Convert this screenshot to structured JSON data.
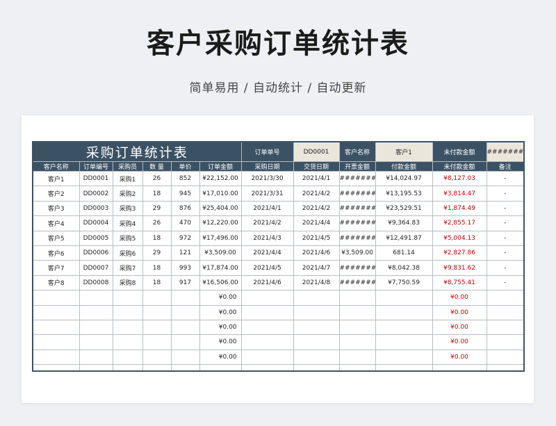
{
  "page": {
    "title": "客户采购订单统计表",
    "subtitle": "简单易用  /  自动统计  /  自动更新"
  },
  "summary": {
    "sheet_title": "采购订单统计表",
    "order_no_label": "订单单号",
    "order_no_value": "DD0001",
    "customer_label": "客户名称",
    "customer_value": "客户1",
    "unpaid_label": "未付款金额",
    "unpaid_value": "#########"
  },
  "columns": [
    "客户名称",
    "订单编号",
    "采购员",
    "数 量",
    "单价",
    "订单金额",
    "采购日期",
    "交货日期",
    "开票金额",
    "付款金额",
    "未付款金额",
    "备注"
  ],
  "rows": [
    [
      "客户1",
      "DD0001",
      "采购1",
      "26",
      "852",
      "¥22,152.00",
      "2021/3/30",
      "2021/4/1",
      "#########",
      "¥14,024.97",
      "¥8,127.03",
      "-"
    ],
    [
      "客户2",
      "DD0002",
      "采购2",
      "18",
      "945",
      "¥17,010.00",
      "2021/3/31",
      "2021/4/2",
      "#########",
      "¥13,195.53",
      "¥3,814.47",
      "-"
    ],
    [
      "客户3",
      "DD0003",
      "采购3",
      "29",
      "876",
      "¥25,404.00",
      "2021/4/1",
      "2021/4/2",
      "#########",
      "¥23,529.51",
      "¥1,874.49",
      "-"
    ],
    [
      "客户4",
      "DD0004",
      "采购4",
      "26",
      "470",
      "¥12,220.00",
      "2021/4/2",
      "2021/4/4",
      "#########",
      "¥9,364.83",
      "¥2,855.17",
      "-"
    ],
    [
      "客户5",
      "DD0005",
      "采购5",
      "18",
      "972",
      "¥17,496.00",
      "2021/4/3",
      "2021/4/5",
      "#########",
      "¥12,491.87",
      "¥5,004.13",
      "-"
    ],
    [
      "客户6",
      "DD0006",
      "采购6",
      "29",
      "121",
      "¥3,509.00",
      "2021/4/4",
      "2021/4/6",
      "¥3,509.00",
      "681.14",
      "¥2,827.86",
      "-"
    ],
    [
      "客户7",
      "DD0007",
      "采购7",
      "18",
      "993",
      "¥17,874.00",
      "2021/4/5",
      "2021/4/7",
      "#########",
      "¥8,042.38",
      "¥9,831.62",
      "-"
    ],
    [
      "客户8",
      "DD0008",
      "采购8",
      "18",
      "917",
      "¥16,506.00",
      "2021/4/6",
      "2021/4/8",
      "#########",
      "¥7,750.59",
      "¥8,755.41",
      "-"
    ],
    [
      "",
      "",
      "",
      "",
      "",
      "¥0.00",
      "",
      "",
      "",
      "",
      "¥0.00",
      ""
    ],
    [
      "",
      "",
      "",
      "",
      "",
      "¥0.00",
      "",
      "",
      "",
      "",
      "¥0.00",
      ""
    ],
    [
      "",
      "",
      "",
      "",
      "",
      "¥0.00",
      "",
      "",
      "",
      "",
      "¥0.00",
      ""
    ],
    [
      "",
      "",
      "",
      "",
      "",
      "¥0.00",
      "",
      "",
      "",
      "",
      "¥0.00",
      ""
    ],
    [
      "",
      "",
      "",
      "",
      "",
      "¥0.00",
      "",
      "",
      "",
      "",
      "¥0.00",
      ""
    ]
  ],
  "colors": {
    "header_bg": "#3b5264",
    "value_bg": "#ebe6dc",
    "unpaid_text": "#c00000"
  }
}
